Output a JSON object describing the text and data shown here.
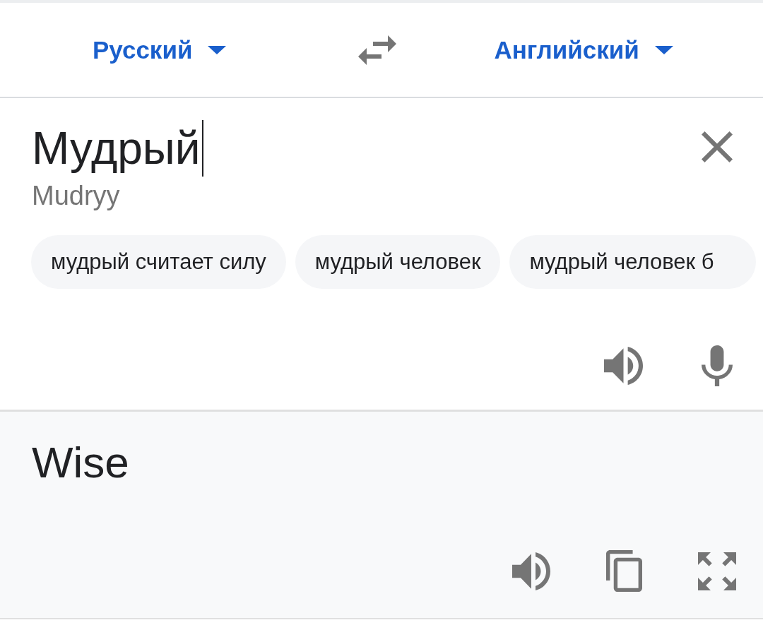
{
  "language_bar": {
    "source_language": "Русский",
    "target_language": "Английский"
  },
  "source": {
    "text": "Мудрый",
    "focused": true,
    "transliteration": "Mudryy",
    "suggestions": [
      "мудрый считает силу",
      "мудрый человек",
      "мудрый человек б"
    ]
  },
  "translation": {
    "text": "Wise"
  }
}
